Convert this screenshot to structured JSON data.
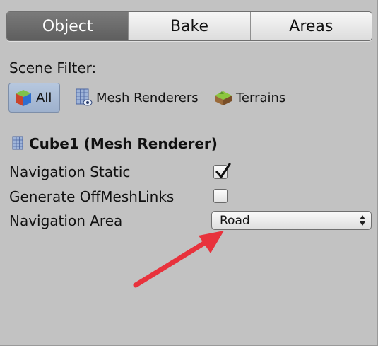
{
  "tabs": [
    {
      "label": "Object",
      "active": true
    },
    {
      "label": "Bake",
      "active": false
    },
    {
      "label": "Areas",
      "active": false
    }
  ],
  "scene_filter": {
    "label": "Scene Filter:",
    "options": [
      {
        "label": "All",
        "icon": "cube-icon",
        "selected": true
      },
      {
        "label": "Mesh Renderers",
        "icon": "mesh-renderer-icon",
        "selected": false
      },
      {
        "label": "Terrains",
        "icon": "terrain-icon",
        "selected": false
      }
    ]
  },
  "object": {
    "title": "Cube1 (Mesh Renderer)",
    "navigation_static": {
      "label": "Navigation Static",
      "checked": true
    },
    "generate_offmeshlinks": {
      "label": "Generate OffMeshLinks",
      "checked": false
    },
    "navigation_area": {
      "label": "Navigation Area",
      "value": "Road"
    }
  },
  "colors": {
    "panel_bg": "#c2c2c2",
    "tab_active": "#6b6b6b",
    "filter_selected": "#aabcd6",
    "annotation_arrow": "#e8323c"
  }
}
